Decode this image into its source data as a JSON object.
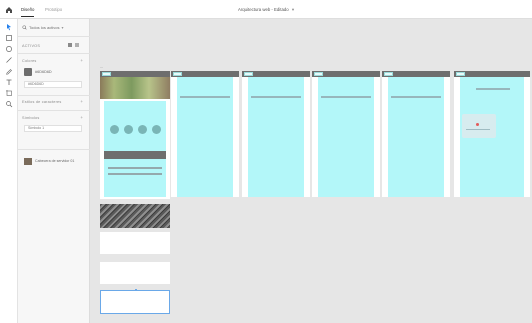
{
  "header": {
    "tabs": [
      {
        "label": "Diseño",
        "active": true
      },
      {
        "label": "Prototipo",
        "active": false
      }
    ],
    "document_title": "Arquitectura web - Editado",
    "document_chevron": "▾"
  },
  "toolbar": {
    "tools": [
      "select-arrow-icon",
      "rectangle-icon",
      "ellipse-icon",
      "line-icon",
      "pen-icon",
      "text-icon",
      "artboard-icon",
      "zoom-icon"
    ]
  },
  "panel": {
    "search_placeholder": "Todos los activos",
    "search_chevron": "▾",
    "assets_title": "ACTIVOS",
    "colors_title": "Colores",
    "color_swatch_value": "#6D6D6D",
    "color_field": "#6D6D6D",
    "char_styles_title": "Estilos de caracteres",
    "components_title": "Símbolos",
    "components_field": "Símbolo 1",
    "component_thumb_label": "Cabecera de servidor 01",
    "plus": "+",
    "accent_color": "#2680eb",
    "artboard_color": "#b3f7f9"
  }
}
